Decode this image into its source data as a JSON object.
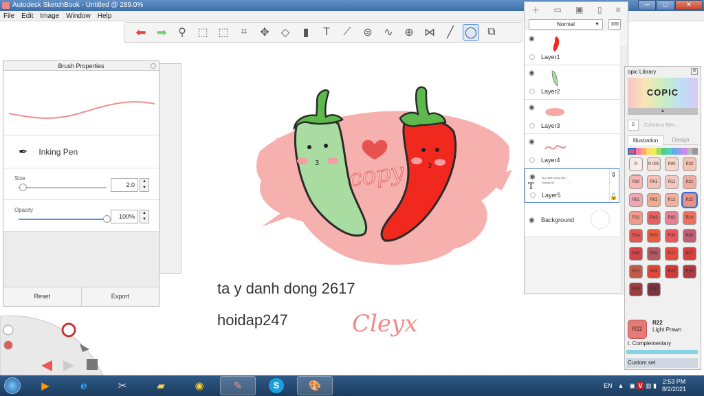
{
  "window": {
    "title": "Autodesk SketchBook - Untitled @ 289.0%",
    "min": "─",
    "max": "□",
    "close": "✕"
  },
  "menu": [
    "File",
    "Edit",
    "Image",
    "Window",
    "Help"
  ],
  "toolbar": {
    "tools": [
      "undo-arrow",
      "redo-arrow",
      "zoom-magnifier",
      "select-rect",
      "select-lasso",
      "crop",
      "move-rotate",
      "distort",
      "symmetry-bucket",
      "text-T",
      "ruler",
      "ellipse-guide",
      "french-curve",
      "perspective",
      "symmetry-x",
      "stroke-line",
      "ellipse-tool-active",
      "copic-shape"
    ]
  },
  "brush": {
    "panel_title": "Brush Properties",
    "name": "Inking Pen",
    "size_label": "Size",
    "size_value": "2.0",
    "size_fraction": 0.05,
    "opacity_label": "Opacity",
    "opacity_value": "100%",
    "opacity_fraction": 1.0,
    "reset": "Reset",
    "export": "Export"
  },
  "layers": {
    "blend_mode": "Normal",
    "opacity_btn": "100",
    "items": [
      {
        "name": "Layer1",
        "thumb": "red-pepper"
      },
      {
        "name": "Layer2",
        "thumb": "green-pepper"
      },
      {
        "name": "Layer3",
        "thumb": "pink-splash"
      },
      {
        "name": "Layer4",
        "thumb": "copy-script"
      },
      {
        "name": "Layer5",
        "thumb": "text-layer",
        "text_preview_1": "ta y danh dong 2617",
        "text_preview_2": "hoidap247"
      },
      {
        "name": "Background",
        "thumb": "white"
      }
    ]
  },
  "copic": {
    "title": "opic Library",
    "logo": "COPIC",
    "colorless": "Colorless Blen...",
    "colorless_code": "0",
    "tabs": [
      "Illustration",
      "Design"
    ],
    "chips": [
      {
        "code": "R 0000",
        "color": "#f9ece6"
      },
      {
        "code": "R 000",
        "color": "#f6dcd3"
      },
      {
        "code": "R00",
        "color": "#f8d7c8"
      },
      {
        "code": "R20",
        "color": "#f7c1b1"
      },
      {
        "code": "R30",
        "color": "#f6b6b2"
      },
      {
        "code": "R01",
        "color": "#f4c0b4"
      },
      {
        "code": "R11",
        "color": "#f4c7c0"
      },
      {
        "code": "R21",
        "color": "#f1aca2"
      },
      {
        "code": "R81",
        "color": "#f0a7b0"
      },
      {
        "code": "R02",
        "color": "#f4a88f"
      },
      {
        "code": "R12",
        "color": "#f2b0a2"
      },
      {
        "code": "R22",
        "color": "#ee8e85"
      },
      {
        "code": "R32",
        "color": "#f19a8c"
      },
      {
        "code": "R43",
        "color": "#e96061"
      },
      {
        "code": "R83",
        "color": "#ea7e95"
      },
      {
        "code": "R14",
        "color": "#ef6f5d"
      },
      {
        "code": "R24",
        "color": "#e45555"
      },
      {
        "code": "R05",
        "color": "#ea5b40"
      },
      {
        "code": "R35",
        "color": "#e8585a"
      },
      {
        "code": "R85",
        "color": "#c25d74"
      },
      {
        "code": "R46",
        "color": "#d4444a"
      },
      {
        "code": "R56",
        "color": "#b2585e"
      },
      {
        "code": "R17",
        "color": "#e14d3a"
      },
      {
        "code": "R27",
        "color": "#d83f3c"
      },
      {
        "code": "R37",
        "color": "#c45a48"
      },
      {
        "code": "R08",
        "color": "#e0483a"
      },
      {
        "code": "R29",
        "color": "#d13a3d"
      },
      {
        "code": "R39",
        "color": "#b03a43"
      },
      {
        "code": "R59",
        "color": "#9e3c3f"
      },
      {
        "code": "R89",
        "color": "#7e3340"
      }
    ],
    "selected": "R22",
    "current_code": "R22",
    "current_name": "Light Prawn",
    "complementary": "t. Complementary",
    "custom_set": "Custom set"
  },
  "canvas_text": {
    "line1": "ta y danh dong 2617",
    "line2": "hoidap247"
  },
  "taskbar": {
    "lang": "EN",
    "time": "2:53 PM",
    "date": "8/2/2021"
  },
  "colors": {
    "pepper_green": "#a8dca0",
    "pepper_red": "#f0281e",
    "splash_pink": "#f6a8a6",
    "accent_blue": "#5a8fd8"
  }
}
